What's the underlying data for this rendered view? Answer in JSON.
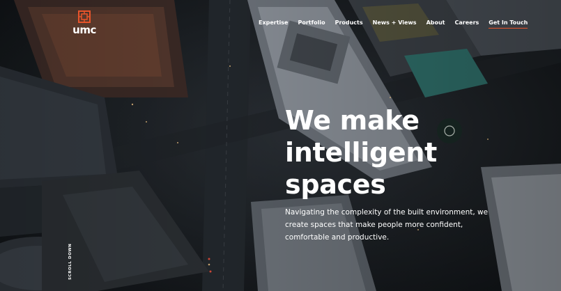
{
  "brand": {
    "name": "umc",
    "accent_color": "#e8542b",
    "logo_icon": "umc-logo-icon"
  },
  "nav": {
    "items": [
      {
        "label": "Expertise"
      },
      {
        "label": "Portfolio"
      },
      {
        "label": "Products"
      },
      {
        "label": "News + Views"
      },
      {
        "label": "About"
      },
      {
        "label": "Careers"
      },
      {
        "label": "Get In Touch"
      }
    ]
  },
  "hero": {
    "headline": "We make\nintelligent\nspaces",
    "subhead": "Navigating the complexity of the built environment, we create spaces that make people more confident, comfortable and productive.",
    "scroll_label": "SCROLL DOWN"
  }
}
